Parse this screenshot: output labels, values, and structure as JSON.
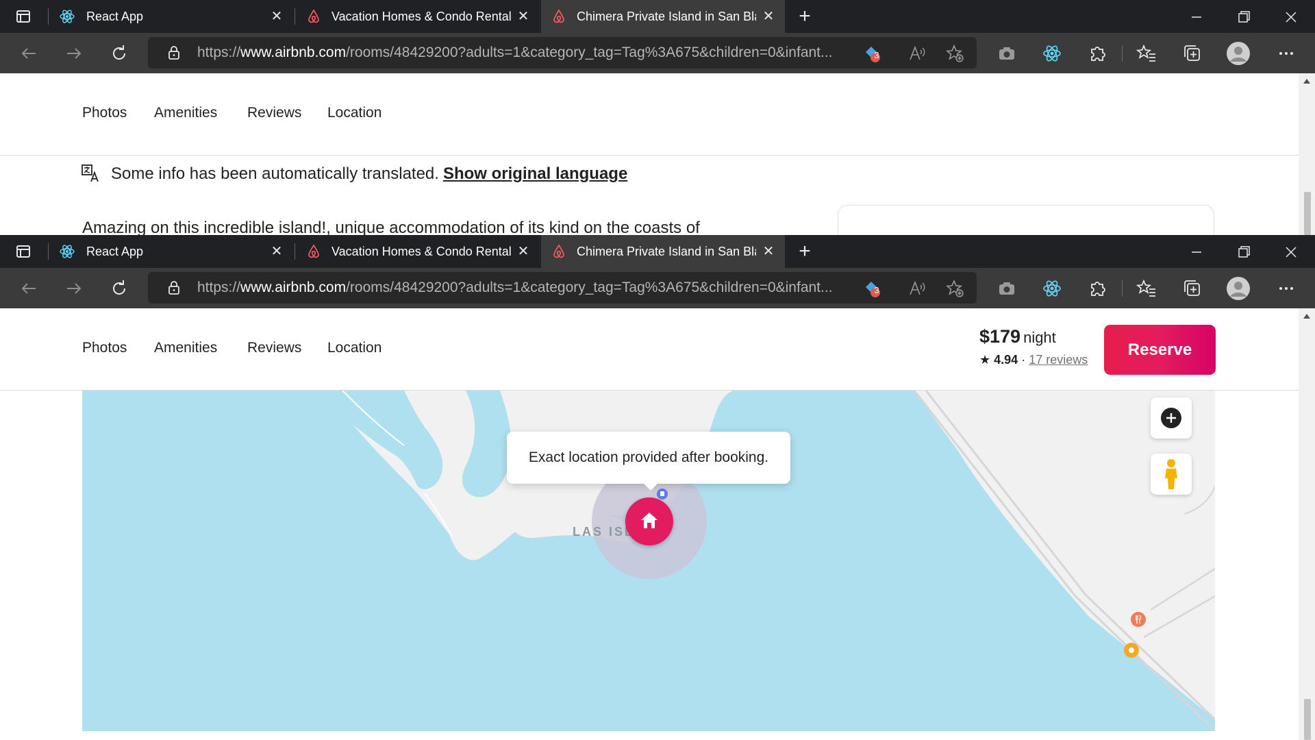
{
  "browser": {
    "tabs": [
      {
        "title": "React App",
        "icon": "react-icon"
      },
      {
        "title": "Vacation Homes & Condo Rental",
        "icon": "airbnb-icon"
      },
      {
        "title": "Chimera Private Island in San Bla",
        "icon": "airbnb-icon",
        "active": true
      }
    ],
    "url_prefix": "https://",
    "url_domain": "www.airbnb.com",
    "url_rest": "/rooms/48429200?adults=1&category_tag=Tag%3A675&children=0&infant...",
    "extension_badge": "3"
  },
  "subnav": {
    "items": [
      "Photos",
      "Amenities",
      "Reviews",
      "Location"
    ]
  },
  "translation_notice": {
    "text": "Some info has been automatically translated.",
    "link": "Show original language"
  },
  "description_start": "Amazing on this incredible island!, unique accommodation of its kind on the coasts of",
  "booking": {
    "price": "$179",
    "unit": "night",
    "rating": "4.94",
    "separator": "·",
    "reviews": "17 reviews",
    "reserve_label": "Reserve"
  },
  "map": {
    "tooltip": "Exact location provided after booking.",
    "area_label": "LAS ISL",
    "colors": {
      "water": "#aee0ef",
      "land": "#f1f1f1",
      "pin": "#e31c5f"
    }
  }
}
